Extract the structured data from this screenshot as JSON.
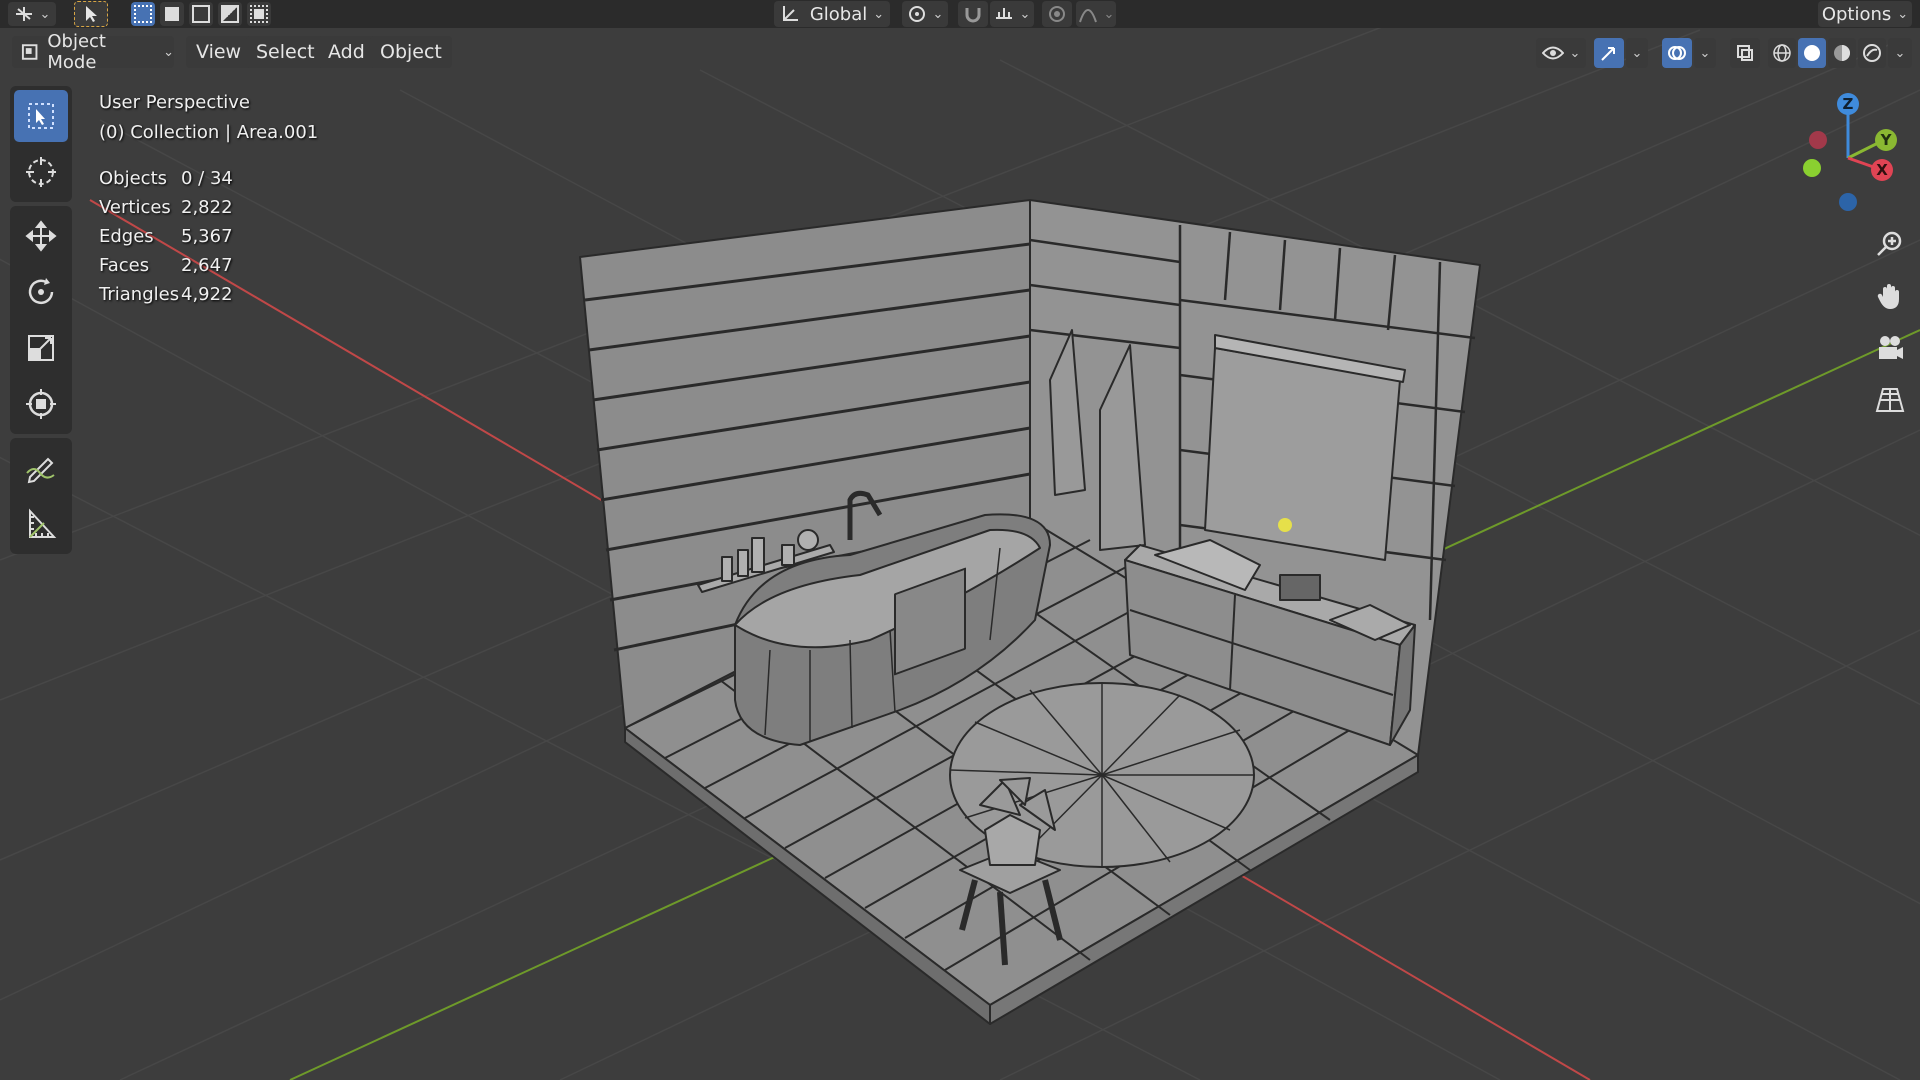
{
  "header": {
    "mode_label": "Object Mode",
    "menus": [
      "View",
      "Select",
      "Add",
      "Object"
    ],
    "transform_orientation": "Global",
    "options_label": "Options"
  },
  "overlay": {
    "view_name": "User Perspective",
    "collection": "(0) Collection | Area.001",
    "stats": [
      {
        "label": "Objects",
        "value": "0 / 34"
      },
      {
        "label": "Vertices",
        "value": "2,822"
      },
      {
        "label": "Edges",
        "value": "5,367"
      },
      {
        "label": "Faces",
        "value": "2,647"
      },
      {
        "label": "Triangles",
        "value": "4,922"
      }
    ]
  },
  "gizmo": {
    "x": "X",
    "y": "Y",
    "z": "Z"
  },
  "icons": {
    "editor_type": "editor-type-icon",
    "select_box": "select-box-icon",
    "cursor": "cursor-icon",
    "move": "move-icon",
    "rotate": "rotate-icon",
    "scale": "scale-icon",
    "transform": "transform-icon",
    "annotate": "annotate-icon",
    "measure": "measure-icon",
    "zoom": "zoom-icon",
    "pan": "hand-icon",
    "camera": "camera-icon",
    "grid": "grid-icon"
  },
  "colors": {
    "viewport_bg": "#3d3d3d",
    "grid_line": "#474747",
    "axis_x": "#c04848",
    "axis_y": "#6e9a2a",
    "active_tool": "#4772b3",
    "model_fill": "#8a8a8a",
    "wire": "#2a2a2a"
  }
}
